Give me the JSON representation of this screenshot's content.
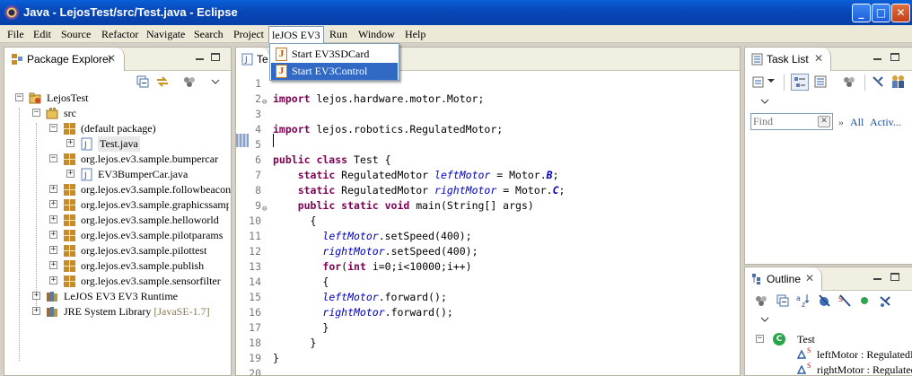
{
  "window": {
    "title": "Java - LejosTest/src/Test.java - Eclipse",
    "minimize_glyph": "_",
    "maximize_glyph": "□",
    "close_glyph": "✕"
  },
  "menu": {
    "items": [
      "File",
      "Edit",
      "Source",
      "Refactor",
      "Navigate",
      "Search",
      "Project",
      "leJOS EV3",
      "Run",
      "Window",
      "Help"
    ],
    "open_item": "leJOS EV3"
  },
  "dropdown": {
    "icon_glyph": "J",
    "items": [
      {
        "label": "Start EV3SDCard",
        "selected": false
      },
      {
        "label": "Start EV3Control",
        "selected": true
      }
    ]
  },
  "package_explorer": {
    "title": "Package Explorer",
    "close_glyph": "✕",
    "tree": [
      {
        "label": "LejosTest",
        "icon": "project-icon",
        "expander": "−"
      },
      {
        "label": "src",
        "icon": "source-folder-icon",
        "expander": "−"
      },
      {
        "label": "(default package)",
        "icon": "package-icon",
        "expander": "−"
      },
      {
        "label": "Test.java",
        "icon": "java-file-icon",
        "expander": "+"
      },
      {
        "label": "org.lejos.ev3.sample.bumpercar",
        "icon": "package-icon",
        "expander": "−"
      },
      {
        "label": "EV3BumperCar.java",
        "icon": "java-file-icon",
        "expander": "+"
      },
      {
        "label": "org.lejos.ev3.sample.followbeacon",
        "icon": "package-icon",
        "expander": "+"
      },
      {
        "label": "org.lejos.ev3.sample.graphicssample",
        "icon": "package-icon",
        "expander": "+"
      },
      {
        "label": "org.lejos.ev3.sample.helloworld",
        "icon": "package-icon",
        "expander": "+"
      },
      {
        "label": "org.lejos.ev3.sample.pilotparams",
        "icon": "package-icon",
        "expander": "+"
      },
      {
        "label": "org.lejos.ev3.sample.pilottest",
        "icon": "package-icon",
        "expander": "+"
      },
      {
        "label": "org.lejos.ev3.sample.publish",
        "icon": "package-icon",
        "expander": "+"
      },
      {
        "label": "org.lejos.ev3.sample.sensorfilter",
        "icon": "package-icon",
        "expander": "+"
      },
      {
        "label": "LeJOS EV3 EV3 Runtime",
        "icon": "library-icon",
        "expander": "+"
      },
      {
        "label": "JRE System Library",
        "suffix": "[JavaSE-1.7]",
        "icon": "library-icon",
        "expander": "+"
      }
    ]
  },
  "editor": {
    "tab_label": "Te",
    "fold_glyph": "⊖",
    "lines": [
      {
        "n": "1",
        "parts": []
      },
      {
        "n": "2",
        "fold": true,
        "parts": [
          [
            "kw",
            "import"
          ],
          [
            "",
            " lejos.hardware.motor.Motor;"
          ]
        ]
      },
      {
        "n": "3",
        "parts": []
      },
      {
        "n": "4",
        "parts": [
          [
            "kw",
            "import"
          ],
          [
            "",
            " lejos.robotics.RegulatedMotor;"
          ]
        ]
      },
      {
        "n": "5",
        "cursor": true,
        "parts": []
      },
      {
        "n": "6",
        "parts": [
          [
            "kw",
            "public class"
          ],
          [
            "",
            " Test {"
          ]
        ]
      },
      {
        "n": "7",
        "parts": [
          [
            "",
            "    "
          ],
          [
            "kw",
            "static"
          ],
          [
            "",
            " RegulatedMotor "
          ],
          [
            "fld",
            "leftMotor"
          ],
          [
            "",
            " = Motor."
          ],
          [
            "sfld",
            "B"
          ],
          [
            "",
            ";"
          ]
        ]
      },
      {
        "n": "8",
        "parts": [
          [
            "",
            "    "
          ],
          [
            "kw",
            "static"
          ],
          [
            "",
            " RegulatedMotor "
          ],
          [
            "fld",
            "rightMotor"
          ],
          [
            "",
            " = Motor."
          ],
          [
            "sfld",
            "C"
          ],
          [
            "",
            ";"
          ]
        ]
      },
      {
        "n": "9",
        "fold": true,
        "parts": [
          [
            "",
            "    "
          ],
          [
            "kw",
            "public static void"
          ],
          [
            "",
            " main(String[] args)"
          ]
        ]
      },
      {
        "n": "10",
        "parts": [
          [
            "",
            "      {"
          ]
        ]
      },
      {
        "n": "11",
        "parts": [
          [
            "",
            "        "
          ],
          [
            "fld",
            "leftMotor"
          ],
          [
            "",
            ".setSpeed(400);"
          ]
        ]
      },
      {
        "n": "12",
        "parts": [
          [
            "",
            "        "
          ],
          [
            "fld",
            "rightMotor"
          ],
          [
            "",
            ".setSpeed(400);"
          ]
        ]
      },
      {
        "n": "13",
        "parts": [
          [
            "",
            "        "
          ],
          [
            "kw",
            "for"
          ],
          [
            "",
            "("
          ],
          [
            "kw",
            "int"
          ],
          [
            "",
            " i=0;i<10000;i++)"
          ]
        ]
      },
      {
        "n": "14",
        "parts": [
          [
            "",
            "        {"
          ]
        ]
      },
      {
        "n": "15",
        "parts": [
          [
            "",
            "        "
          ],
          [
            "fld",
            "leftMotor"
          ],
          [
            "",
            ".forward();"
          ]
        ]
      },
      {
        "n": "16",
        "parts": [
          [
            "",
            "        "
          ],
          [
            "fld",
            "rightMotor"
          ],
          [
            "",
            ".forward();"
          ]
        ]
      },
      {
        "n": "17",
        "parts": [
          [
            "",
            "        }"
          ]
        ]
      },
      {
        "n": "18",
        "parts": [
          [
            "",
            "      }"
          ]
        ]
      },
      {
        "n": "19",
        "parts": [
          [
            "",
            "}"
          ]
        ]
      },
      {
        "n": "20",
        "parts": []
      }
    ]
  },
  "task_list": {
    "title": "Task List",
    "close_glyph": "✕",
    "find_placeholder": "Find",
    "clear_glyph": "✕",
    "filter_arrow": "»",
    "filter_all": "All",
    "filter_active": "Activ..."
  },
  "outline": {
    "title": "Outline",
    "close_glyph": "✕",
    "class_glyph": "C",
    "items": [
      {
        "label": "Test",
        "icon": "class-icon"
      },
      {
        "label": "leftMotor : RegulatedM",
        "icon": "field-icon",
        "modifier": "S"
      },
      {
        "label": "rightMotor : Regulated",
        "icon": "field-icon",
        "modifier": "S"
      }
    ]
  },
  "colors": {
    "keyword": "#7f0055",
    "field": "#0000c0",
    "selection": "#316ac5",
    "titlebar": "#0a5fd8"
  }
}
